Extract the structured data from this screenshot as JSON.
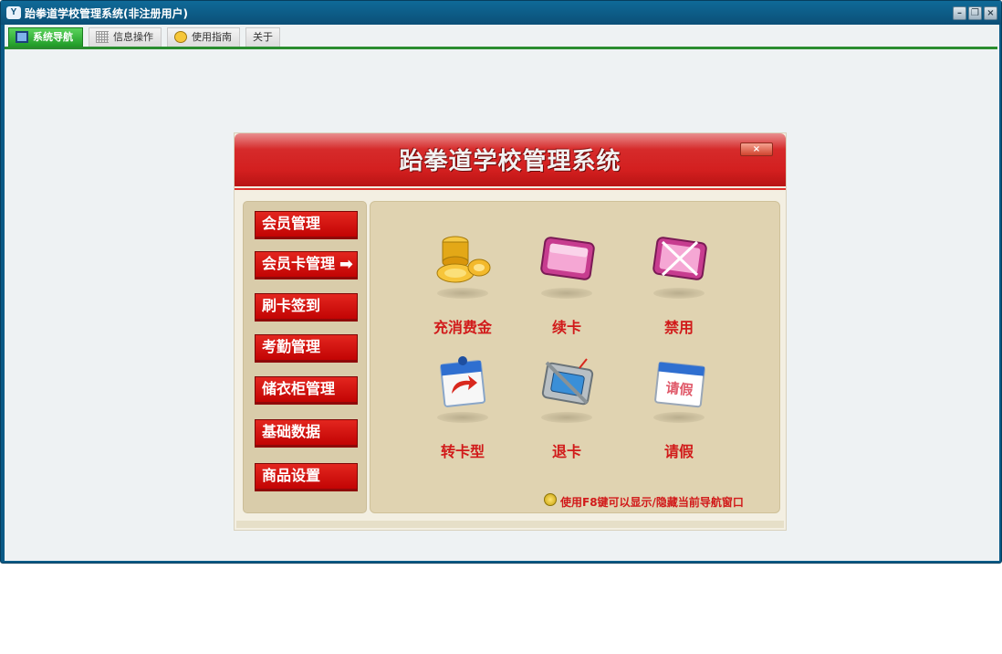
{
  "window": {
    "title": "跆拳道学校管理系统(非注册用户)",
    "icon_text": "Y",
    "min_glyph": "–",
    "max_glyph": "❐",
    "close_glyph": "×"
  },
  "tabs": [
    {
      "label": "系统导航",
      "icon": "monitor-icon",
      "active": true
    },
    {
      "label": "信息操作",
      "icon": "grid-icon"
    },
    {
      "label": "使用指南",
      "icon": "smiley-icon"
    },
    {
      "label": "关于"
    }
  ],
  "panel": {
    "title": "跆拳道学校管理系统",
    "close_glyph": "×",
    "sidebar": [
      {
        "label": "会员管理"
      },
      {
        "label": "会员卡管理",
        "arrow": "➡"
      },
      {
        "label": "刷卡签到"
      },
      {
        "label": "考勤管理"
      },
      {
        "label": "储衣柜管理"
      },
      {
        "label": "基础数据"
      },
      {
        "label": "商品设置"
      }
    ],
    "actions": [
      {
        "label": "充消费金",
        "icon": "gold-coins-icon"
      },
      {
        "label": "续卡",
        "icon": "card-icon"
      },
      {
        "label": "禁用",
        "icon": "card-disabled-icon"
      },
      {
        "label": "转卡型",
        "icon": "calendar-refresh-icon"
      },
      {
        "label": "退卡",
        "icon": "card-return-icon"
      },
      {
        "label": "请假",
        "icon": "calendar-leave-icon",
        "badge": "请假"
      }
    ],
    "hint": "使用F8键可以显示/隐藏当前导航窗口"
  },
  "colors": {
    "titlebar": "#0b4f77",
    "tab_active": "#1f9a26",
    "panel_red": "#d31f1f",
    "label_red": "#d11a1a",
    "content_bg": "#e0d3b1"
  }
}
